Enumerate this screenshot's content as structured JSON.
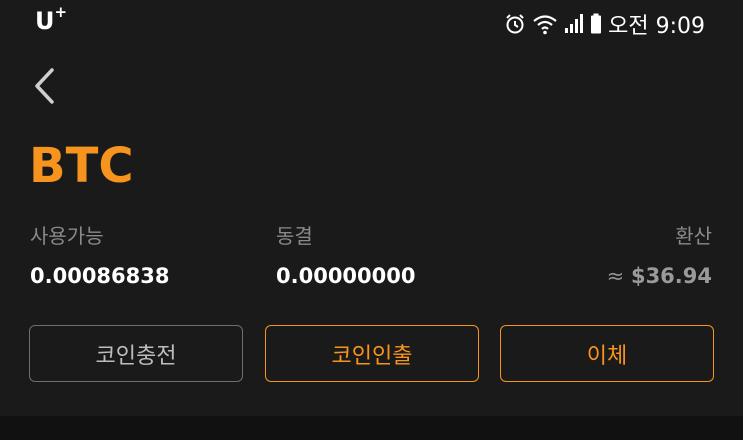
{
  "status_bar": {
    "carrier": "U",
    "carrier_sup": "+",
    "time": "오전 9:09",
    "icons": [
      "alarm-icon",
      "wifi-icon",
      "signal-icon",
      "battery-icon"
    ]
  },
  "header": {
    "back_icon": "chevron-left-icon"
  },
  "coin": {
    "symbol": "BTC",
    "color": "#f7941d"
  },
  "balances": {
    "available_label": "사용가능",
    "available_value": "0.00086838",
    "frozen_label": "동결",
    "frozen_value": "0.00000000",
    "converted_label": "환산",
    "converted_prefix": "≈ ",
    "converted_value": "$36.94"
  },
  "actions": {
    "deposit_label": "코인충전",
    "withdraw_label": "코인인출",
    "transfer_label": "이체"
  }
}
